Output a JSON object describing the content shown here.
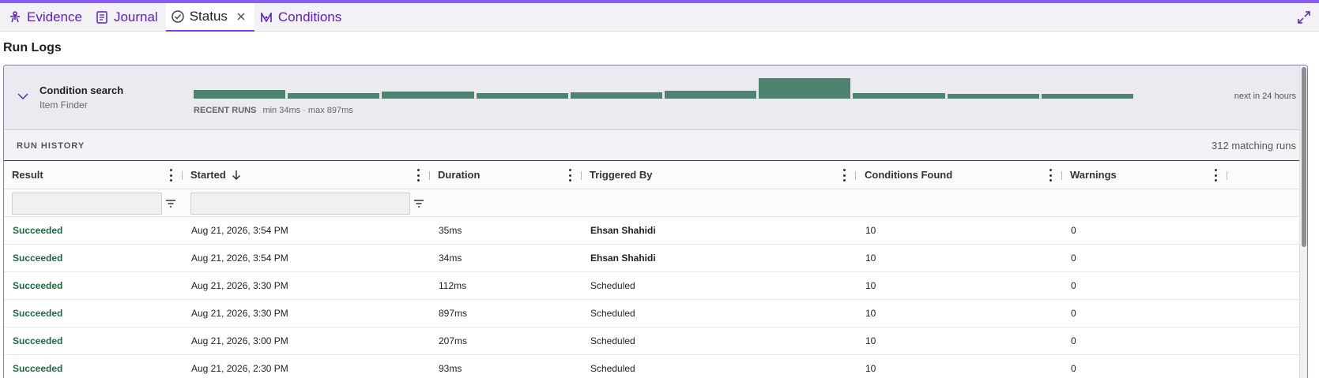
{
  "tabs": [
    {
      "label": "Evidence",
      "icon": "evidence-icon"
    },
    {
      "label": "Journal",
      "icon": "journal-icon"
    },
    {
      "label": "Status",
      "icon": "check-circle-icon",
      "active": true
    },
    {
      "label": "Conditions",
      "icon": "conditions-icon"
    }
  ],
  "page_title": "Run Logs",
  "summary": {
    "title": "Condition search",
    "subtitle": "Item Finder",
    "recent_runs_label": "RECENT RUNS",
    "recent_runs_range": "min 34ms · max 897ms",
    "next_run": "next in 24 hours",
    "bar_values_ms": [
      93,
      58,
      75,
      60,
      62,
      80,
      210,
      55,
      48,
      50
    ]
  },
  "history": {
    "label": "RUN HISTORY",
    "count": "312 matching runs"
  },
  "columns": [
    "Result",
    "Started",
    "Duration",
    "Triggered By",
    "Conditions Found",
    "Warnings"
  ],
  "rows": [
    {
      "result": "Succeeded",
      "started": "Aug 21, 2026, 3:54 PM",
      "duration": "35ms",
      "triggered_by": "Ehsan Shahidi",
      "user": true,
      "found": "10",
      "warnings": "0"
    },
    {
      "result": "Succeeded",
      "started": "Aug 21, 2026, 3:54 PM",
      "duration": "34ms",
      "triggered_by": "Ehsan Shahidi",
      "user": true,
      "found": "10",
      "warnings": "0"
    },
    {
      "result": "Succeeded",
      "started": "Aug 21, 2026, 3:30 PM",
      "duration": "112ms",
      "triggered_by": "Scheduled",
      "user": false,
      "found": "10",
      "warnings": "0"
    },
    {
      "result": "Succeeded",
      "started": "Aug 21, 2026, 3:30 PM",
      "duration": "897ms",
      "triggered_by": "Scheduled",
      "user": false,
      "found": "10",
      "warnings": "0"
    },
    {
      "result": "Succeeded",
      "started": "Aug 21, 2026, 3:00 PM",
      "duration": "207ms",
      "triggered_by": "Scheduled",
      "user": false,
      "found": "10",
      "warnings": "0"
    },
    {
      "result": "Succeeded",
      "started": "Aug 21, 2026, 2:30 PM",
      "duration": "93ms",
      "triggered_by": "Scheduled",
      "user": false,
      "found": "10",
      "warnings": "0"
    }
  ],
  "colors": {
    "accent": "#7c3aed",
    "success": "#1d6b3e",
    "bar": "#4f8370"
  }
}
